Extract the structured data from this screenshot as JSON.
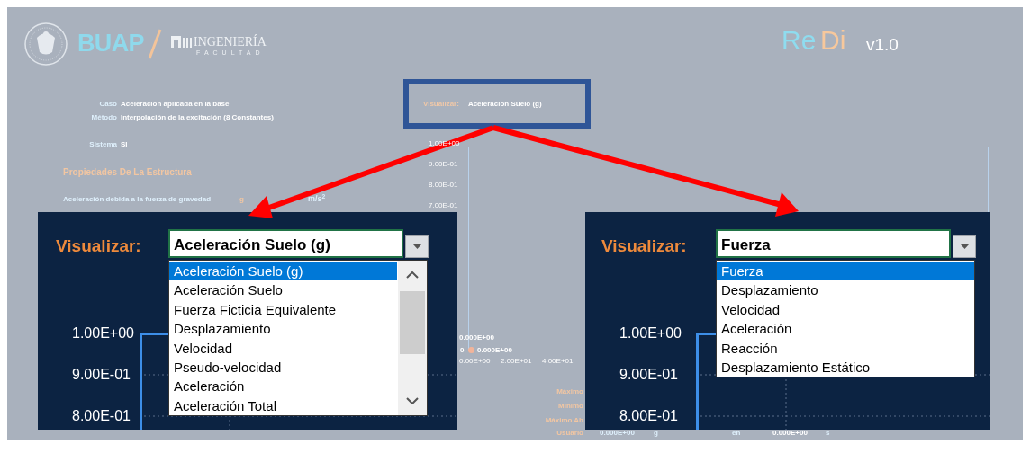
{
  "header": {
    "university": "BUAP",
    "faculty_name": "INGENIERÍA",
    "faculty_sub": "FACULTAD",
    "app_name_parts": [
      "Re",
      "Di"
    ],
    "version": "v1.0"
  },
  "info": [
    {
      "label": "Caso",
      "value": "Aceleración aplicada en la base"
    },
    {
      "label": "Método",
      "value": "Interpolación de la excitación (8 Constantes)"
    },
    {
      "label": "Sistema",
      "value": "SI"
    }
  ],
  "section_title": "Propiedades De La Estructura",
  "property": {
    "label": "Aceleración debida a la fuerza de gravedad",
    "symbol": "g",
    "unit": "m/s$^{2}$"
  },
  "visualizar": {
    "label": "Visualizar:",
    "value": "Aceleración Suelo (g)"
  },
  "background_chart": {
    "y_ticks": [
      "1.00E+00",
      "9.00E-01",
      "8.00E-01",
      "7.00E-01"
    ],
    "x_ticks": [
      "0.00E+00",
      "2.00E+01",
      "4.00E+01"
    ],
    "point_labels": [
      "0.000E+00",
      "0",
      "0.000E+00"
    ]
  },
  "stats": {
    "labels": [
      "Máximo",
      "Mínimo",
      "Máximo Ab",
      "Usuario"
    ],
    "user_value": "0.000E+00",
    "user_unit": "g",
    "at_label": "en",
    "time_value": "0.000E+00",
    "time_unit": "s"
  },
  "zoom_panels": [
    {
      "label": "Visualizar:",
      "value": "Aceleración Suelo (g)",
      "scrollbar": true,
      "y_ticks": [
        "1.00E+00",
        "9.00E-01",
        "8.00E-01"
      ],
      "options": [
        {
          "label": "Aceleración Suelo (g)",
          "selected": true
        },
        {
          "label": "Aceleración Suelo",
          "selected": false
        },
        {
          "label": "Fuerza Ficticia Equivalente",
          "selected": false
        },
        {
          "label": "Desplazamiento",
          "selected": false
        },
        {
          "label": "Velocidad",
          "selected": false
        },
        {
          "label": "Pseudo-velocidad",
          "selected": false
        },
        {
          "label": "Aceleración",
          "selected": false
        },
        {
          "label": "Aceleración Total",
          "selected": false
        }
      ]
    },
    {
      "label": "Visualizar:",
      "value": "Fuerza",
      "scrollbar": false,
      "y_ticks": [
        "1.00E+00",
        "9.00E-01",
        "8.00E-01"
      ],
      "options": [
        {
          "label": "Fuerza",
          "selected": true
        },
        {
          "label": "Desplazamiento",
          "selected": false
        },
        {
          "label": "Velocidad",
          "selected": false
        },
        {
          "label": "Aceleración",
          "selected": false
        },
        {
          "label": "Reacción",
          "selected": false
        },
        {
          "label": "Desplazamiento Estático",
          "selected": false
        }
      ]
    }
  ]
}
